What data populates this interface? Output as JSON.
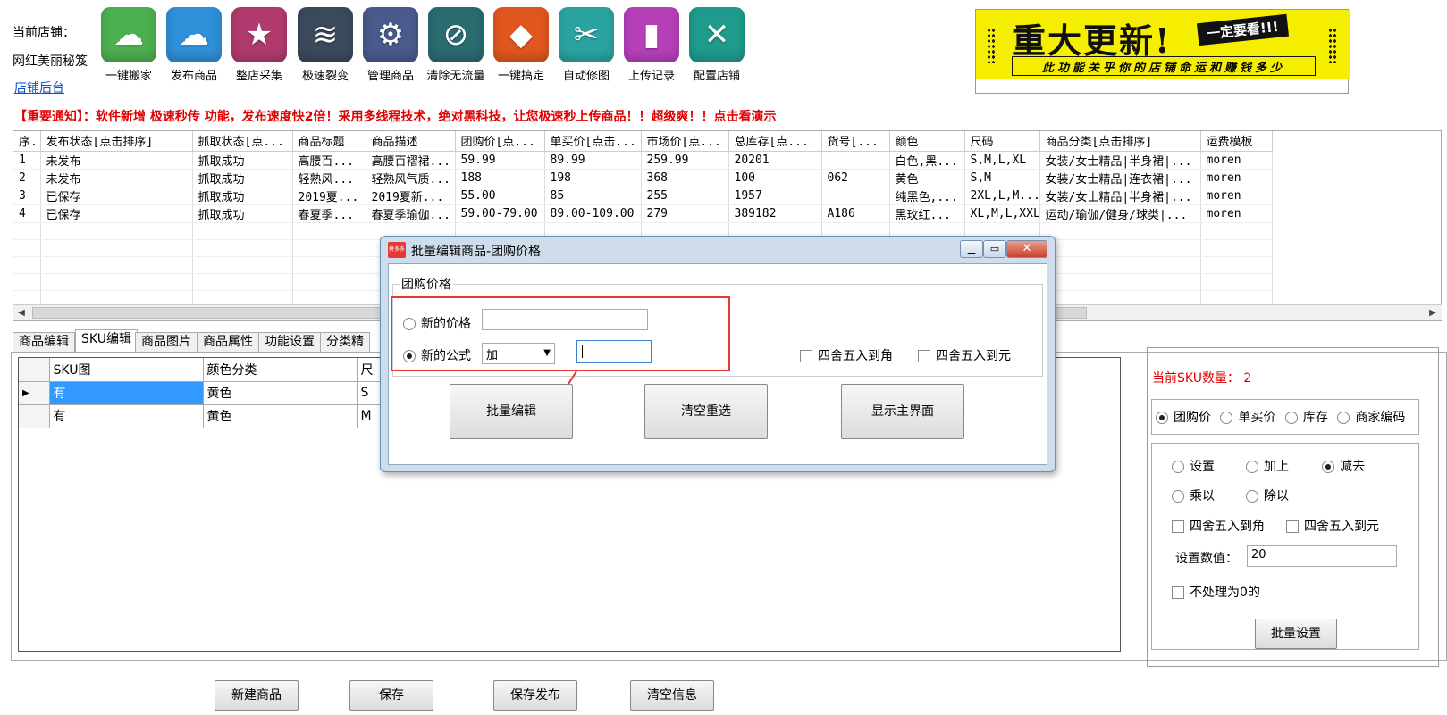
{
  "top": {
    "store_label": "当前店铺：",
    "store_name": "网红美丽秘笈",
    "store_backend_link": "店铺后台"
  },
  "toolbar": [
    {
      "label": "一键搬家",
      "icon": "download-cloud-icon",
      "color": "#4caf50"
    },
    {
      "label": "发布商品",
      "icon": "upload-cloud-icon",
      "color": "#2f8fd8"
    },
    {
      "label": "整店采集",
      "icon": "star-icon",
      "color": "#b03a6e"
    },
    {
      "label": "极速裂变",
      "icon": "layers-icon",
      "color": "#3a4a5c"
    },
    {
      "label": "管理商品",
      "icon": "gear-icon",
      "color": "#4a5a8c"
    },
    {
      "label": "清除无流量",
      "icon": "no-entry-icon",
      "color": "#2a6b70"
    },
    {
      "label": "一键搞定",
      "icon": "tag-icon",
      "color": "#e0571e"
    },
    {
      "label": "自动修图",
      "icon": "scissors-icon",
      "color": "#2aa3a0"
    },
    {
      "label": "上传记录",
      "icon": "bookmark-icon",
      "color": "#b540b8"
    },
    {
      "label": "配置店铺",
      "icon": "tools-icon",
      "color": "#1e9b8c"
    }
  ],
  "banner": {
    "headline": "重大更新!",
    "tag": "一定要看!!!",
    "subtitle": "此功能关乎你的店铺命运和赚钱多少",
    "bg_color": "#f5ee00"
  },
  "notice": "【重要通知】：软件新增 极速秒传 功能，发布速度快2倍！采用多线程技术，绝对黑科技，让您极速秒上传商品！！超级爽！！点击看演示",
  "product_grid": {
    "columns": [
      "序..",
      "发布状态[点击排序]",
      "抓取状态[点...",
      "商品标题",
      "商品描述",
      "团购价[点...",
      "单买价[点击...",
      "市场价[点...",
      "总库存[点...",
      "货号[...",
      "颜色",
      "尺码",
      "商品分类[点击排序]",
      "运费模板"
    ],
    "rows": [
      [
        "1",
        "未发布",
        "抓取成功",
        "高腰百...",
        "高腰百褶裙...",
        "59.99",
        "89.99",
        "259.99",
        "20201",
        "",
        "白色,黑...",
        "S,M,L,XL",
        "女装/女士精品|半身裙|...",
        "moren"
      ],
      [
        "2",
        "未发布",
        "抓取成功",
        "轻熟风...",
        "轻熟风气质...",
        "188",
        "198",
        "368",
        "100",
        "062",
        "黄色",
        "S,M",
        "女装/女士精品|连衣裙|...",
        "moren"
      ],
      [
        "3",
        "已保存",
        "抓取成功",
        "2019夏...",
        "2019夏新...",
        "55.00",
        "85",
        "255",
        "1957",
        "",
        "纯黑色,...",
        "2XL,L,M...",
        "女装/女士精品|半身裙|...",
        "moren"
      ],
      [
        "4",
        "已保存",
        "抓取成功",
        "春夏季...",
        "春夏季瑜伽...",
        "59.00-79.00",
        "89.00-109.00",
        "279",
        "389182",
        "A186",
        "黑玫红...",
        "XL,M,L,XXL",
        "运动/瑜伽/健身/球类|...",
        "moren"
      ]
    ]
  },
  "tabs": [
    "商品编辑",
    "SKU编辑",
    "商品图片",
    "商品属性",
    "功能设置",
    "分类精"
  ],
  "sku_grid": {
    "columns": [
      "SKU图",
      "颜色分类",
      "尺"
    ],
    "rows": [
      [
        "有",
        "黄色",
        "S"
      ],
      [
        "有",
        "黄色",
        "M"
      ]
    ]
  },
  "right_panel": {
    "sku_count_label": "当前SKU数量： 2",
    "price_types": [
      "团购价",
      "单买价",
      "库存",
      "商家编码"
    ],
    "ops": [
      "设置",
      "加上",
      "减去",
      "乘以",
      "除以"
    ],
    "round_jiao": "四舍五入到角",
    "round_yuan": "四舍五入到元",
    "set_value_label": "设置数值：",
    "set_value": "20",
    "zero_label": "不处理为0的",
    "batch_set_button": "批量设置"
  },
  "bottom_buttons": [
    "新建商品",
    "保存",
    "保存发布",
    "清空信息"
  ],
  "dialog": {
    "app_icon_text": "拼多多",
    "title": "批量编辑商品-团购价格",
    "group_label": "团购价格",
    "new_price_label": "新的价格",
    "new_price_value": "",
    "new_formula_label": "新的公式",
    "formula_op": "加",
    "formula_value": "",
    "round_jiao": "四舍五入到角",
    "round_yuan": "四舍五入到元",
    "batch_edit_button": "批量编辑",
    "clear_button": "清空重选",
    "show_main_button": "显示主界面",
    "highlight_color": "#e53935"
  }
}
